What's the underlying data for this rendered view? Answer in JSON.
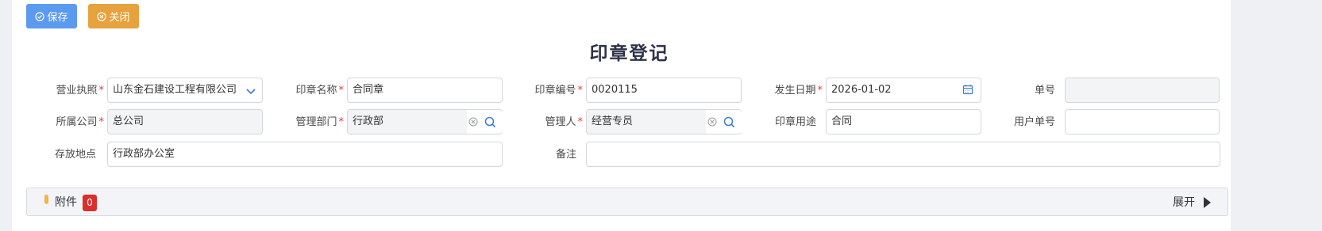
{
  "toolbar": {
    "save_label": "保存",
    "close_label": "关闭"
  },
  "page_title": "印章登记",
  "form": {
    "business_license": {
      "label": "营业执照",
      "value": "山东金石建设工程有限公司"
    },
    "seal_name": {
      "label": "印章名称",
      "value": "合同章"
    },
    "seal_number": {
      "label": "印章编号",
      "value": "0020115"
    },
    "occur_date": {
      "label": "发生日期",
      "value": "2026-01-02"
    },
    "doc_number": {
      "label": "单号",
      "value": ""
    },
    "company": {
      "label": "所属公司",
      "value": "总公司"
    },
    "department": {
      "label": "管理部门",
      "value": "行政部"
    },
    "manager": {
      "label": "管理人",
      "value": "经营专员"
    },
    "seal_usage": {
      "label": "印章用途",
      "value": "合同"
    },
    "user_doc_number": {
      "label": "用户单号",
      "value": ""
    },
    "storage_location": {
      "label": "存放地点",
      "value": "行政部办公室"
    },
    "remark": {
      "label": "备注",
      "value": ""
    },
    "required_mark": "*"
  },
  "attachments": {
    "label": "附件",
    "count": "0",
    "expand_label": "展开"
  },
  "colors": {
    "save_button": "#5b9bef",
    "close_button": "#e6a23c",
    "required": "#e03d3d",
    "badge": "#d9302c",
    "icon_blue": "#3a7bd5"
  }
}
